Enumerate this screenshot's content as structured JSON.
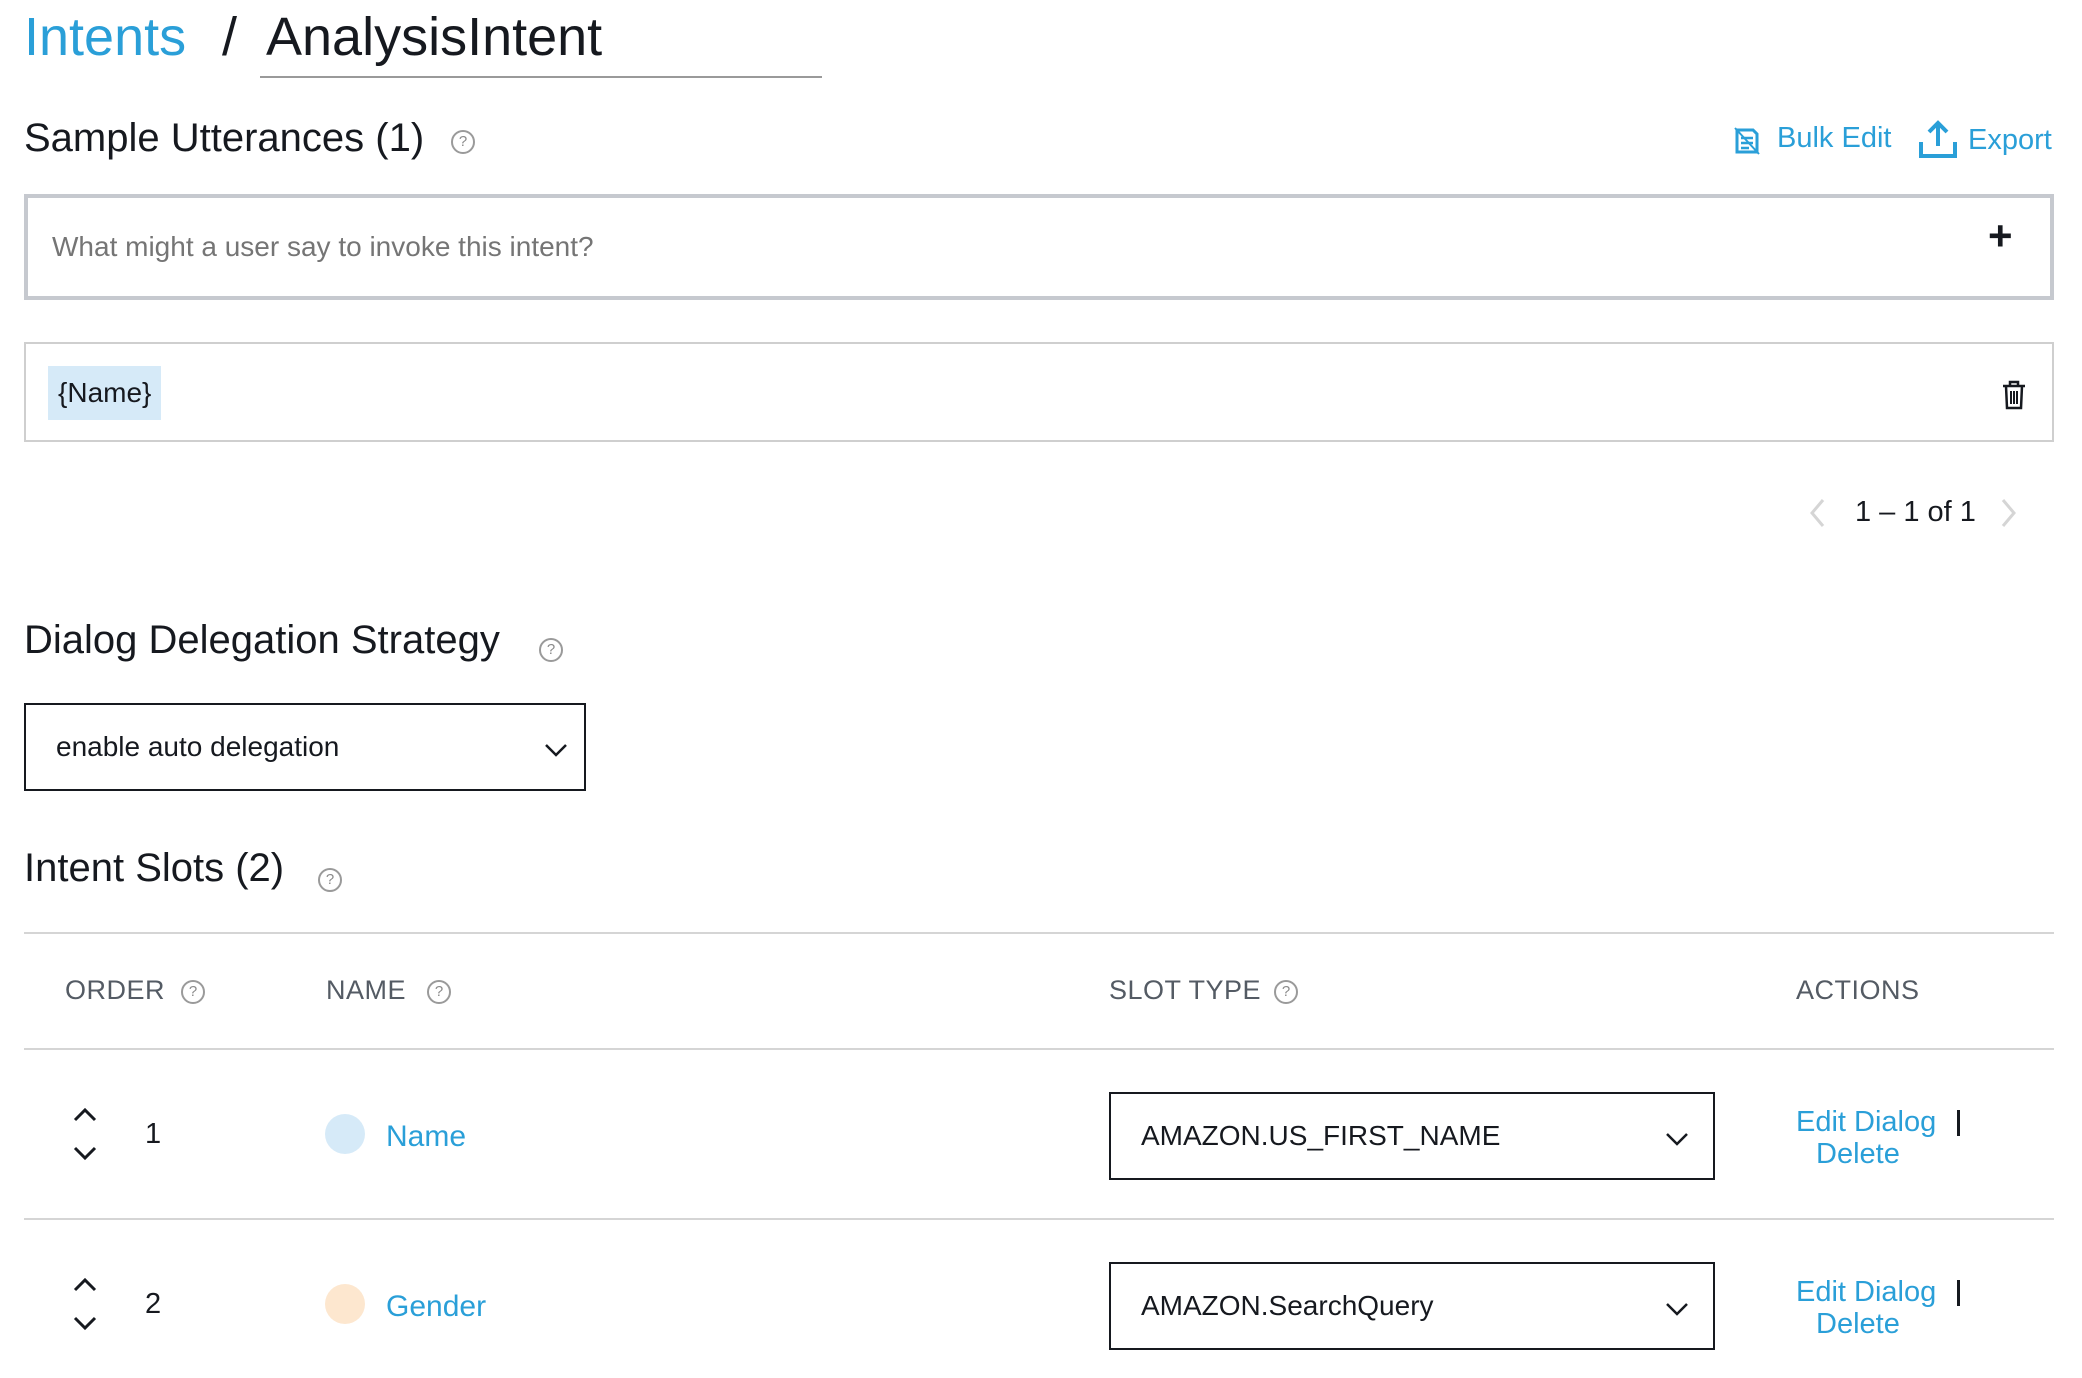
{
  "breadcrumb": {
    "parent": "Intents",
    "separator": "/",
    "current": "AnalysisIntent"
  },
  "utterances": {
    "title": "Sample Utterances (1)",
    "bulk_edit": "Bulk Edit",
    "export": "Export",
    "input_placeholder": "What might a user say to invoke this intent?",
    "add_symbol": "+",
    "items": [
      {
        "text": "{Name}"
      }
    ],
    "pagination": "1 – 1 of 1"
  },
  "delegation": {
    "title": "Dialog Delegation Strategy",
    "selected": "enable auto delegation"
  },
  "slots": {
    "title": "Intent Slots (2)",
    "columns": {
      "order": "ORDER",
      "name": "NAME",
      "slot_type": "SLOT TYPE",
      "actions": "ACTIONS"
    },
    "rows": [
      {
        "order": "1",
        "name": "Name",
        "slot_type": "AMAZON.US_FIRST_NAME",
        "dot_color": "#d6eaf8",
        "edit": "Edit Dialog",
        "delete": "Delete"
      },
      {
        "order": "2",
        "name": "Gender",
        "slot_type": "AMAZON.SearchQuery",
        "dot_color": "#fde7cf",
        "edit": "Edit Dialog",
        "delete": "Delete"
      }
    ]
  },
  "colors": {
    "link": "#2a9fd8",
    "text": "#16191f",
    "slot_highlight": "#d6eaf8"
  }
}
